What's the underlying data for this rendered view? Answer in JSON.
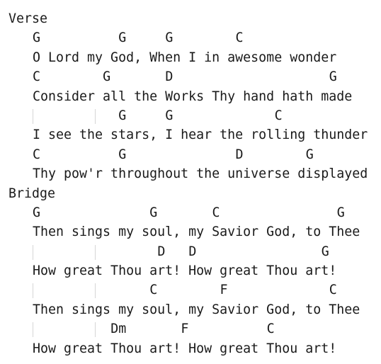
{
  "sections": [
    {
      "name": "Verse",
      "lines": [
        {
          "bars": 0,
          "chords": [
            {
              "ch": "G",
              "col": 0
            },
            {
              "ch": "G",
              "col": 11
            },
            {
              "ch": "G",
              "col": 17
            },
            {
              "ch": "C",
              "col": 26
            }
          ],
          "lyric": "O Lord my God, When I in awesome wonder"
        },
        {
          "bars": 0,
          "chords": [
            {
              "ch": "C",
              "col": 0
            },
            {
              "ch": "G",
              "col": 9
            },
            {
              "ch": "D",
              "col": 17
            },
            {
              "ch": "G",
              "col": 38
            }
          ],
          "lyric": "Consider all the Works Thy hand hath made"
        },
        {
          "bars": 2,
          "chords": [
            {
              "ch": "G",
              "col": 11
            },
            {
              "ch": "G",
              "col": 17
            },
            {
              "ch": "C",
              "col": 31
            }
          ],
          "lyric": "I see the stars, I hear the rolling thunder"
        },
        {
          "bars": 0,
          "chords": [
            {
              "ch": "C",
              "col": 0
            },
            {
              "ch": "G",
              "col": 11
            },
            {
              "ch": "D",
              "col": 26
            },
            {
              "ch": "G",
              "col": 35
            }
          ],
          "lyric": "Thy pow'r throughout the universe displayed"
        }
      ]
    },
    {
      "name": "Bridge",
      "lines": [
        {
          "bars": 0,
          "chords": [
            {
              "ch": "G",
              "col": 0
            },
            {
              "ch": "G",
              "col": 15
            },
            {
              "ch": "C",
              "col": 23
            },
            {
              "ch": "G",
              "col": 39
            }
          ],
          "lyric": "Then sings my soul, my Savior God, to Thee"
        },
        {
          "bars": 2,
          "chords": [
            {
              "ch": "D",
              "col": 16
            },
            {
              "ch": "D",
              "col": 20
            },
            {
              "ch": "G",
              "col": 37
            }
          ],
          "lyric": "How great Thou art! How great Thou art!"
        },
        {
          "bars": 2,
          "chords": [
            {
              "ch": "C",
              "col": 15
            },
            {
              "ch": "F",
              "col": 24
            },
            {
              "ch": "C",
              "col": 38
            }
          ],
          "lyric": "Then sings my soul, my Savior God, to Thee"
        },
        {
          "bars": 2,
          "chords": [
            {
              "ch": "Dm",
              "col": 10
            },
            {
              "ch": "F",
              "col": 19
            },
            {
              "ch": "C",
              "col": 30
            }
          ],
          "lyric": "How great Thou art! How great Thou art!"
        }
      ]
    }
  ]
}
